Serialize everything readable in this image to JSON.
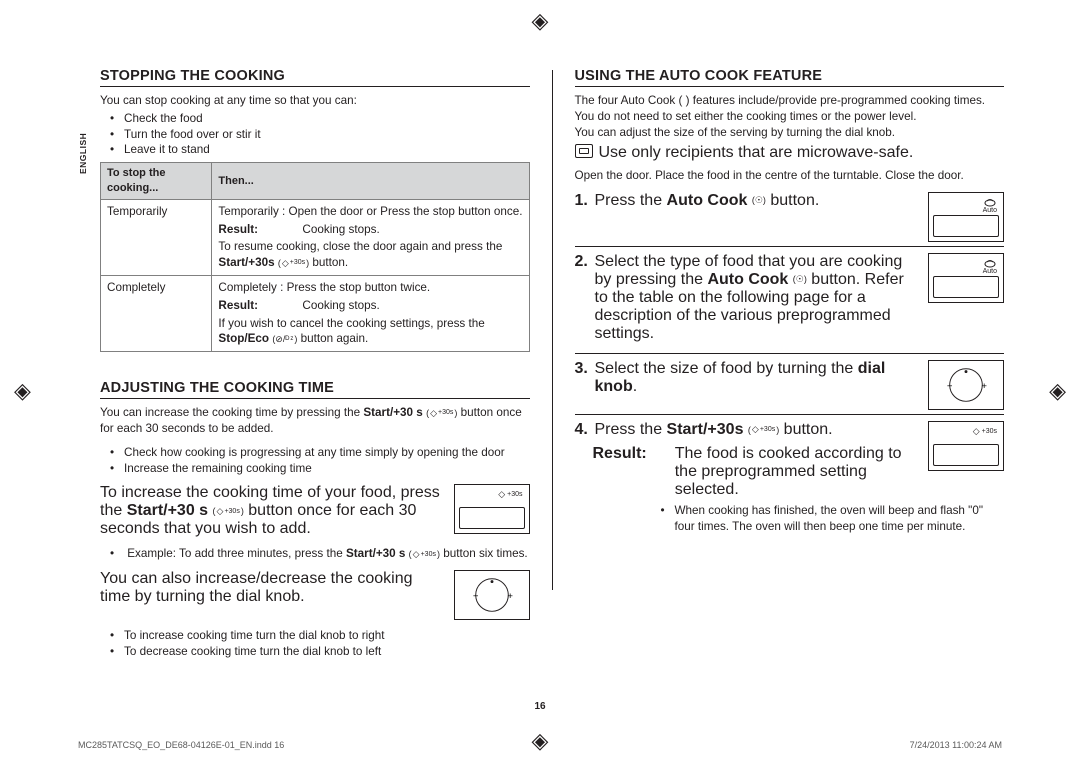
{
  "lang_tab": "ENGLISH",
  "left": {
    "h_stop": "STOPPING THE COOKING",
    "stop_intro": "You can stop cooking at any time so that you can:",
    "stop_bullets": [
      "Check the food",
      "Turn the food over or stir it",
      "Leave it to stand"
    ],
    "table": {
      "th1": "To stop the cooking...",
      "th2": "Then...",
      "r1c1": "Temporarily",
      "r1_l1": "Temporarily : Open the door or Press the stop button once.",
      "r1_res_label": "Result:",
      "r1_res_val": "Cooking stops.",
      "r1_l2a": "To resume cooking, close the door again and press the ",
      "r1_l2b": "Start/+30s",
      "r1_l2c": " button.",
      "r2c1": "Completely",
      "r2_l1": "Completely : Press the stop button twice.",
      "r2_res_label": "Result:",
      "r2_res_val": "Cooking stops.",
      "r2_l2a": "If you wish to cancel the cooking settings, press the ",
      "r2_l2b": "Stop/Eco",
      "r2_l2c": " button again."
    },
    "h_adj": "ADJUSTING THE COOKING TIME",
    "adj_p1a": "You can increase the cooking time by pressing the ",
    "adj_p1b": "Start/+30 s",
    "adj_p1c": " button once for each 30 seconds to be added.",
    "adj_b1": "Check how cooking is progressing at any time simply by opening the door",
    "adj_b2": "Increase the remaining cooking time",
    "adj_p2a": "To increase the cooking time of your food, press the ",
    "adj_p2b": "Start/+30 s",
    "adj_p2c": " button once for each 30 seconds that you wish to add.",
    "adj_ex_a": "Example: To add three minutes, press the ",
    "adj_ex_b": "Start/+30 s",
    "adj_ex_c": " button six times.",
    "adj_p3": "You can also increase/decrease the cooking time by turning the dial knob.",
    "adj_b3": "To increase cooking time turn the dial knob to right",
    "adj_b4": "To decrease cooking time turn the dial knob to left"
  },
  "right": {
    "h_auto": "USING THE AUTO COOK FEATURE",
    "p1": "The four Auto Cook (      ) features include/provide pre-programmed cooking times. You do not need to set either the cooking times or the power level.",
    "p2": "You can adjust the size of the serving by turning the dial knob.",
    "note": "Use only recipients that are microwave-safe.",
    "p3": "Open the door. Place the food in the centre of the turntable. Close the door.",
    "s1_a": "Press the ",
    "s1_b": "Auto Cook",
    "s1_c": " button.",
    "s2_a": "Select the type of food that you are cooking by pressing the ",
    "s2_b": "Auto Cook",
    "s2_c": " button. Refer to the table on the following page for a description of the various preprogrammed settings.",
    "s3_a": "Select the size of food by turning the ",
    "s3_b": "dial knob",
    "s3_c": ".",
    "s4_a": "Press the ",
    "s4_b": "Start/+30s",
    "s4_c": " button.",
    "res_label": "Result:",
    "res_val": "The food is cooked according to the preprogrammed setting selected.",
    "res_b1": "When cooking has finished, the oven will beep and flash \"0\" four times. The oven will then beep one time per minute."
  },
  "icons": {
    "start30": "+30s",
    "auto": "Auto",
    "pot": "pot-icon",
    "diamond": "◇"
  },
  "footer": {
    "left": "MC285TATCSQ_EO_DE68-04126E-01_EN.indd   16",
    "right": "7/24/2013   11:00:24 AM",
    "page": "16"
  }
}
